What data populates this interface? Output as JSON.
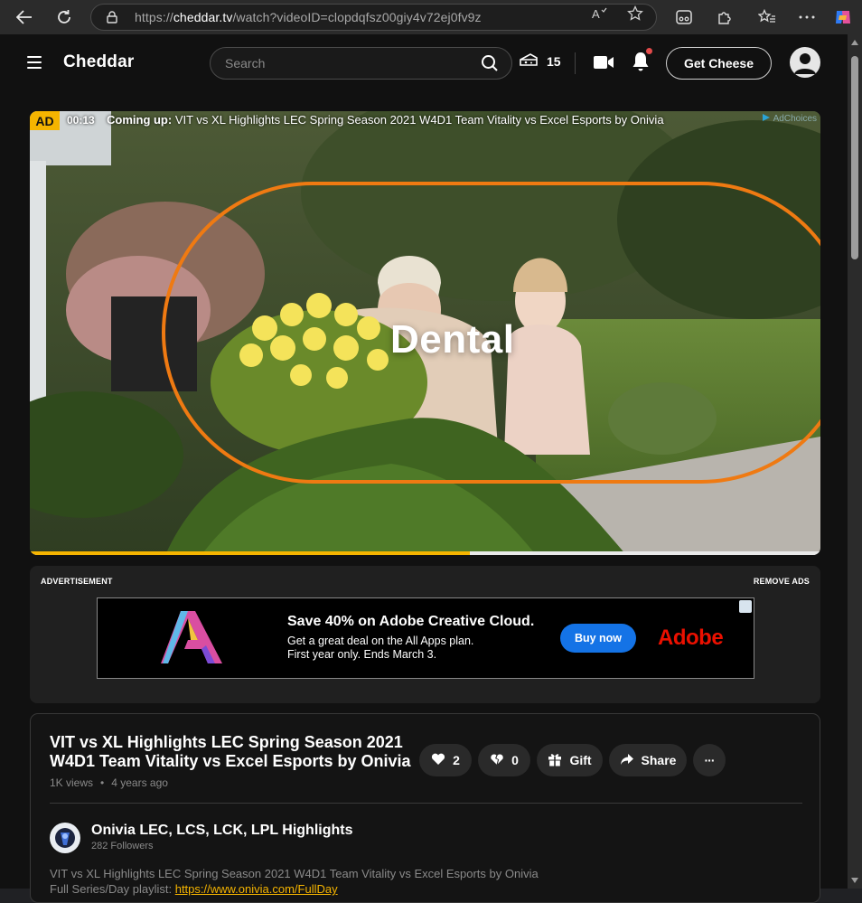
{
  "browser": {
    "url_host": "cheddar.tv",
    "url_prefix": "https://",
    "url_path": "/watch?videoID=clopdqfsz00giy4v72ej0fv9z"
  },
  "header": {
    "logo": "Cheddar",
    "search_placeholder": "Search",
    "cheese_count": "15",
    "get_cheese_label": "Get Cheese"
  },
  "player": {
    "ad_badge": "AD",
    "ad_time": "00:13",
    "coming_up_label": "Coming up:",
    "coming_up_title": " VIT vs XL Highlights LEC Spring Season 2021 W4D1 Team Vitality vs Excel Esports by Onivia",
    "adchoices": "AdChoices",
    "overlay_word": "Dental",
    "progress_fraction": 0.557
  },
  "advertisement": {
    "label": "ADVERTISEMENT",
    "remove_ads": "REMOVE ADS",
    "headline": "Save 40% on Adobe Creative Cloud.",
    "line1": "Get a great deal on the All Apps plan.",
    "line2": "First year only. Ends March 3.",
    "cta": "Buy now",
    "brand": "Adobe"
  },
  "video": {
    "title": "VIT vs XL Highlights LEC Spring Season 2021 W4D1 Team Vitality vs Excel Esports by Onivia",
    "views": "1K views",
    "separator": "•",
    "age": "4 years ago",
    "likes": "2",
    "dislikes": "0",
    "gift_label": "Gift",
    "share_label": "Share",
    "more_label": "···"
  },
  "channel": {
    "name": "Onivia LEC, LCS, LCK, LPL Highlights",
    "followers": "282 Followers"
  },
  "description": {
    "line1": "VIT vs XL Highlights LEC Spring Season 2021 W4D1 Team Vitality vs Excel Esports by Onivia",
    "playlist_label": "Full Series/Day playlist: ",
    "playlist_link": "https://www.onivia.com/FullDay"
  },
  "colors": {
    "accent": "#f5b400",
    "ad_cta": "#1473e6",
    "adobe_red": "#eb1000"
  }
}
